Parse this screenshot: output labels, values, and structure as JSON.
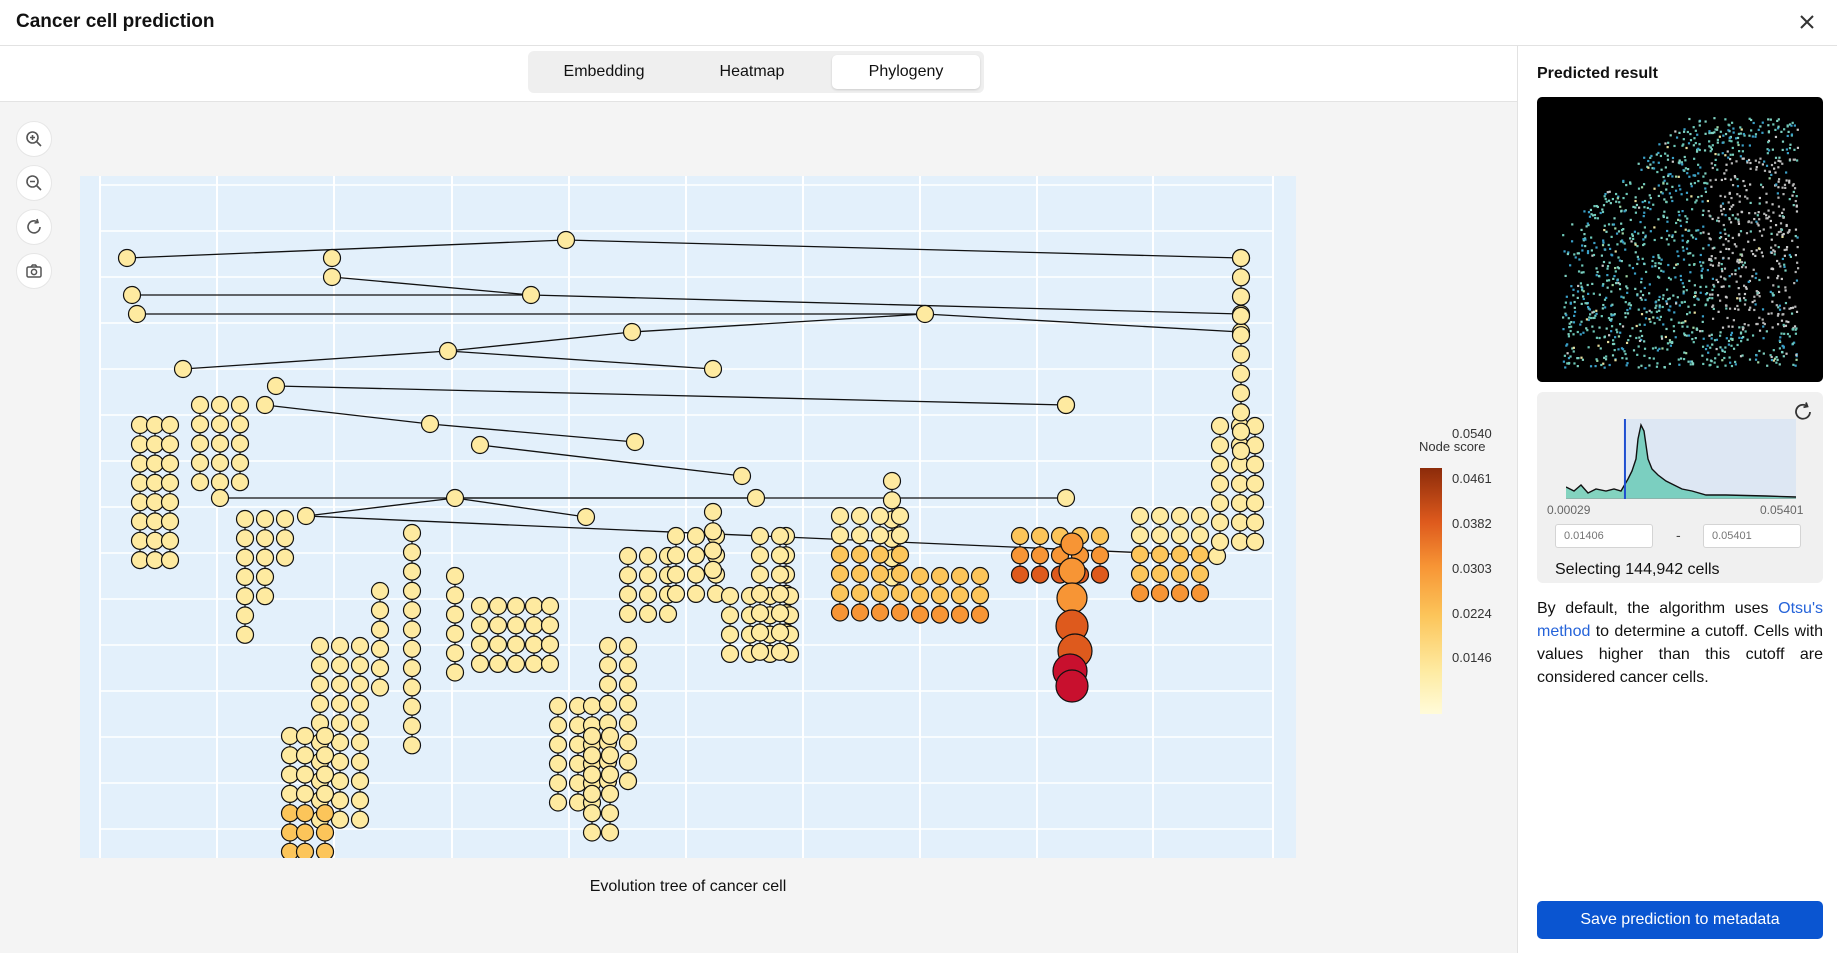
{
  "window": {
    "title": "Cancer cell prediction"
  },
  "tabs": [
    {
      "label": "Embedding",
      "active": false
    },
    {
      "label": "Heatmap",
      "active": false
    },
    {
      "label": "Phylogeny",
      "active": true
    }
  ],
  "toolbar": {
    "icons": [
      "zoom-in-icon",
      "zoom-out-icon",
      "reset-icon",
      "camera-icon"
    ]
  },
  "chart_data": {
    "type": "scatter",
    "title": "Evolution tree of cancer cell",
    "legend": {
      "title": "Node score",
      "placement": "right",
      "ticks": [
        "0.0540",
        "0.0461",
        "0.0382",
        "0.0303",
        "0.0224",
        "0.0146"
      ]
    },
    "colorscale": [
      "#fffbd9",
      "#feeaa0",
      "#fcc55a",
      "#f79535",
      "#de5a1d",
      "#c8102e"
    ],
    "nodes": "rendered as tree of scored nodes (node score 0.0146 – 0.0540)"
  },
  "side_panel": {
    "title": "Predicted result",
    "histogram": {
      "min_label": "0.00029",
      "max_label": "0.05401",
      "cutoff": 0.01406
    },
    "range_min_placeholder": "0.01406",
    "range_max_placeholder": "0.05401",
    "range_dash": "-",
    "selecting_text": "Selecting 144,942 cells",
    "desc_before": "By default, the algorithm uses ",
    "desc_link": "Otsu's method",
    "desc_after": " to determine a cutoff. Cells with values higher than this cutoff are considered cancer cells.",
    "save_button": "Save prediction to metadata"
  }
}
